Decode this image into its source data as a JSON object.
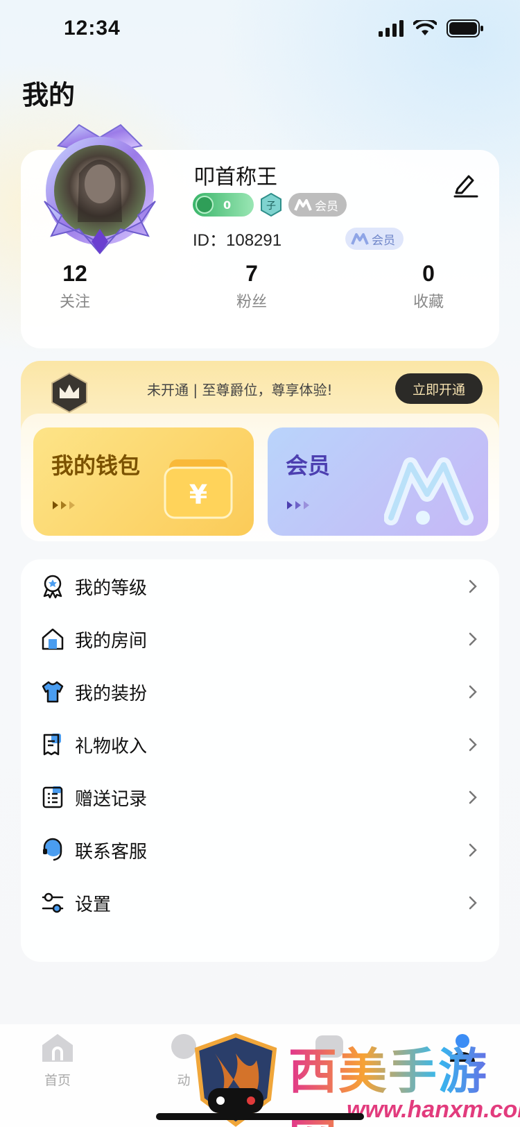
{
  "status_bar": {
    "time": "12:34"
  },
  "page": {
    "title": "我的"
  },
  "profile": {
    "nickname": "叩首称王",
    "level_value": "0",
    "vip_badge": "会员",
    "id_text": "ID：108291",
    "vip_chip": "会员",
    "stats": [
      {
        "value": "12",
        "label": "关注"
      },
      {
        "value": "7",
        "label": "粉丝"
      },
      {
        "value": "0",
        "label": "收藏"
      }
    ]
  },
  "vip_banner": {
    "text": "未开通 | 至尊爵位，尊享体验!",
    "button": "立即开通"
  },
  "cards": {
    "wallet": "我的钱包",
    "member": "会员"
  },
  "menu": {
    "items": [
      {
        "label": "我的等级",
        "icon": "badge-icon"
      },
      {
        "label": "我的房间",
        "icon": "house-icon"
      },
      {
        "label": "我的装扮",
        "icon": "shirt-icon"
      },
      {
        "label": "礼物收入",
        "icon": "receipt-icon"
      },
      {
        "label": "赠送记录",
        "icon": "list-icon"
      },
      {
        "label": "联系客服",
        "icon": "headset-icon"
      },
      {
        "label": "设置",
        "icon": "settings-icon"
      }
    ]
  },
  "tabbar": {
    "tabs": [
      {
        "label": "首页"
      },
      {
        "label": "动"
      }
    ]
  },
  "watermark": {
    "text": "西美手游网",
    "url": "www.hanxm.com"
  },
  "colors": {
    "accent_gold": "#fbcb58",
    "accent_purple": "#c6b7f6",
    "dark_button": "#2b2a27"
  }
}
